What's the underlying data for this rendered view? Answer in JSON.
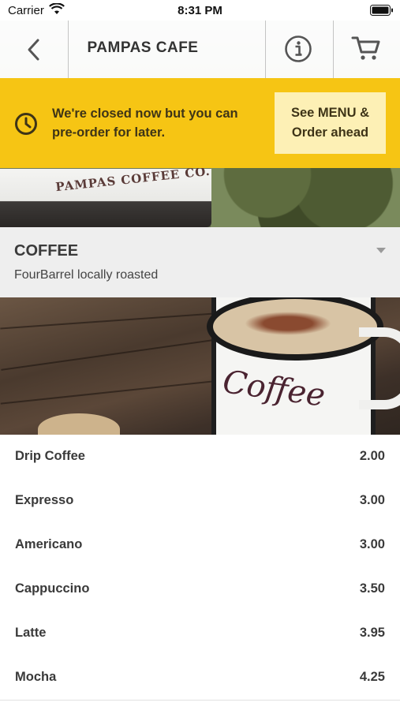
{
  "status_bar": {
    "carrier": "Carrier",
    "time": "8:31 PM"
  },
  "nav": {
    "title": "PAMPAS CAFE",
    "back_icon": "chevron-left-icon",
    "info_icon": "info-circle-icon",
    "cart_icon": "cart-icon"
  },
  "banner": {
    "message": "We're closed now but you can pre-order for later.",
    "button_label": "See MENU & Order ahead",
    "bg_color": "#f6c514",
    "button_color": "#fdf0b5",
    "icon": "clock-icon"
  },
  "hero": {
    "sign_text": "PAMPAS COFFEE CO."
  },
  "category": {
    "title": "COFFEE",
    "subtitle": "FourBarrel locally roasted",
    "image_word": "Coffee"
  },
  "items": [
    {
      "name": "Drip Coffee",
      "price": "2.00"
    },
    {
      "name": "Expresso",
      "price": "3.00"
    },
    {
      "name": "Americano",
      "price": "3.00"
    },
    {
      "name": "Cappuccino",
      "price": "3.50"
    },
    {
      "name": "Latte",
      "price": "3.95"
    },
    {
      "name": "Mocha",
      "price": "4.25"
    }
  ]
}
